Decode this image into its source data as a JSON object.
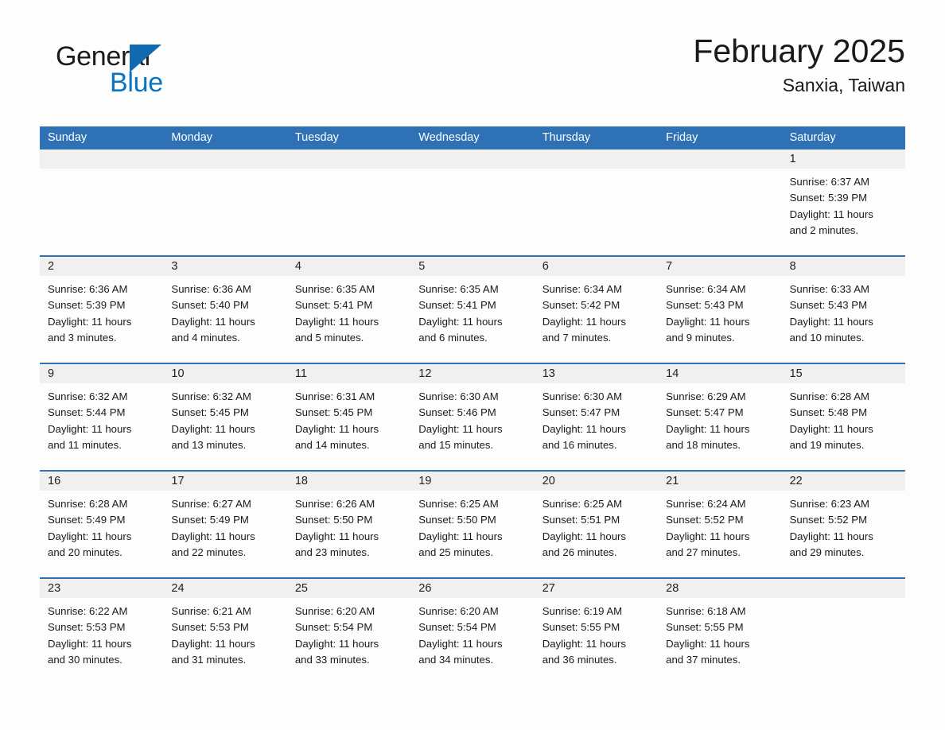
{
  "brand": {
    "name_part1": "General",
    "name_part2": "Blue",
    "accent_color": "#0a73c2",
    "triangle_color": "#1169b0"
  },
  "header": {
    "title": "February 2025",
    "subtitle": "Sanxia, Taiwan"
  },
  "calendar": {
    "header_bg": "#2e71b4",
    "header_text_color": "#ffffff",
    "daynum_band_bg": "#f0f0f0",
    "weekdays": [
      "Sunday",
      "Monday",
      "Tuesday",
      "Wednesday",
      "Thursday",
      "Friday",
      "Saturday"
    ],
    "weeks": [
      [
        {
          "day": "",
          "empty": true
        },
        {
          "day": "",
          "empty": true
        },
        {
          "day": "",
          "empty": true
        },
        {
          "day": "",
          "empty": true
        },
        {
          "day": "",
          "empty": true
        },
        {
          "day": "",
          "empty": true
        },
        {
          "day": "1",
          "sunrise": "Sunrise: 6:37 AM",
          "sunset": "Sunset: 5:39 PM",
          "daylight_line1": "Daylight: 11 hours",
          "daylight_line2": "and 2 minutes."
        }
      ],
      [
        {
          "day": "2",
          "sunrise": "Sunrise: 6:36 AM",
          "sunset": "Sunset: 5:39 PM",
          "daylight_line1": "Daylight: 11 hours",
          "daylight_line2": "and 3 minutes."
        },
        {
          "day": "3",
          "sunrise": "Sunrise: 6:36 AM",
          "sunset": "Sunset: 5:40 PM",
          "daylight_line1": "Daylight: 11 hours",
          "daylight_line2": "and 4 minutes."
        },
        {
          "day": "4",
          "sunrise": "Sunrise: 6:35 AM",
          "sunset": "Sunset: 5:41 PM",
          "daylight_line1": "Daylight: 11 hours",
          "daylight_line2": "and 5 minutes."
        },
        {
          "day": "5",
          "sunrise": "Sunrise: 6:35 AM",
          "sunset": "Sunset: 5:41 PM",
          "daylight_line1": "Daylight: 11 hours",
          "daylight_line2": "and 6 minutes."
        },
        {
          "day": "6",
          "sunrise": "Sunrise: 6:34 AM",
          "sunset": "Sunset: 5:42 PM",
          "daylight_line1": "Daylight: 11 hours",
          "daylight_line2": "and 7 minutes."
        },
        {
          "day": "7",
          "sunrise": "Sunrise: 6:34 AM",
          "sunset": "Sunset: 5:43 PM",
          "daylight_line1": "Daylight: 11 hours",
          "daylight_line2": "and 9 minutes."
        },
        {
          "day": "8",
          "sunrise": "Sunrise: 6:33 AM",
          "sunset": "Sunset: 5:43 PM",
          "daylight_line1": "Daylight: 11 hours",
          "daylight_line2": "and 10 minutes."
        }
      ],
      [
        {
          "day": "9",
          "sunrise": "Sunrise: 6:32 AM",
          "sunset": "Sunset: 5:44 PM",
          "daylight_line1": "Daylight: 11 hours",
          "daylight_line2": "and 11 minutes."
        },
        {
          "day": "10",
          "sunrise": "Sunrise: 6:32 AM",
          "sunset": "Sunset: 5:45 PM",
          "daylight_line1": "Daylight: 11 hours",
          "daylight_line2": "and 13 minutes."
        },
        {
          "day": "11",
          "sunrise": "Sunrise: 6:31 AM",
          "sunset": "Sunset: 5:45 PM",
          "daylight_line1": "Daylight: 11 hours",
          "daylight_line2": "and 14 minutes."
        },
        {
          "day": "12",
          "sunrise": "Sunrise: 6:30 AM",
          "sunset": "Sunset: 5:46 PM",
          "daylight_line1": "Daylight: 11 hours",
          "daylight_line2": "and 15 minutes."
        },
        {
          "day": "13",
          "sunrise": "Sunrise: 6:30 AM",
          "sunset": "Sunset: 5:47 PM",
          "daylight_line1": "Daylight: 11 hours",
          "daylight_line2": "and 16 minutes."
        },
        {
          "day": "14",
          "sunrise": "Sunrise: 6:29 AM",
          "sunset": "Sunset: 5:47 PM",
          "daylight_line1": "Daylight: 11 hours",
          "daylight_line2": "and 18 minutes."
        },
        {
          "day": "15",
          "sunrise": "Sunrise: 6:28 AM",
          "sunset": "Sunset: 5:48 PM",
          "daylight_line1": "Daylight: 11 hours",
          "daylight_line2": "and 19 minutes."
        }
      ],
      [
        {
          "day": "16",
          "sunrise": "Sunrise: 6:28 AM",
          "sunset": "Sunset: 5:49 PM",
          "daylight_line1": "Daylight: 11 hours",
          "daylight_line2": "and 20 minutes."
        },
        {
          "day": "17",
          "sunrise": "Sunrise: 6:27 AM",
          "sunset": "Sunset: 5:49 PM",
          "daylight_line1": "Daylight: 11 hours",
          "daylight_line2": "and 22 minutes."
        },
        {
          "day": "18",
          "sunrise": "Sunrise: 6:26 AM",
          "sunset": "Sunset: 5:50 PM",
          "daylight_line1": "Daylight: 11 hours",
          "daylight_line2": "and 23 minutes."
        },
        {
          "day": "19",
          "sunrise": "Sunrise: 6:25 AM",
          "sunset": "Sunset: 5:50 PM",
          "daylight_line1": "Daylight: 11 hours",
          "daylight_line2": "and 25 minutes."
        },
        {
          "day": "20",
          "sunrise": "Sunrise: 6:25 AM",
          "sunset": "Sunset: 5:51 PM",
          "daylight_line1": "Daylight: 11 hours",
          "daylight_line2": "and 26 minutes."
        },
        {
          "day": "21",
          "sunrise": "Sunrise: 6:24 AM",
          "sunset": "Sunset: 5:52 PM",
          "daylight_line1": "Daylight: 11 hours",
          "daylight_line2": "and 27 minutes."
        },
        {
          "day": "22",
          "sunrise": "Sunrise: 6:23 AM",
          "sunset": "Sunset: 5:52 PM",
          "daylight_line1": "Daylight: 11 hours",
          "daylight_line2": "and 29 minutes."
        }
      ],
      [
        {
          "day": "23",
          "sunrise": "Sunrise: 6:22 AM",
          "sunset": "Sunset: 5:53 PM",
          "daylight_line1": "Daylight: 11 hours",
          "daylight_line2": "and 30 minutes."
        },
        {
          "day": "24",
          "sunrise": "Sunrise: 6:21 AM",
          "sunset": "Sunset: 5:53 PM",
          "daylight_line1": "Daylight: 11 hours",
          "daylight_line2": "and 31 minutes."
        },
        {
          "day": "25",
          "sunrise": "Sunrise: 6:20 AM",
          "sunset": "Sunset: 5:54 PM",
          "daylight_line1": "Daylight: 11 hours",
          "daylight_line2": "and 33 minutes."
        },
        {
          "day": "26",
          "sunrise": "Sunrise: 6:20 AM",
          "sunset": "Sunset: 5:54 PM",
          "daylight_line1": "Daylight: 11 hours",
          "daylight_line2": "and 34 minutes."
        },
        {
          "day": "27",
          "sunrise": "Sunrise: 6:19 AM",
          "sunset": "Sunset: 5:55 PM",
          "daylight_line1": "Daylight: 11 hours",
          "daylight_line2": "and 36 minutes."
        },
        {
          "day": "28",
          "sunrise": "Sunrise: 6:18 AM",
          "sunset": "Sunset: 5:55 PM",
          "daylight_line1": "Daylight: 11 hours",
          "daylight_line2": "and 37 minutes."
        },
        {
          "day": "",
          "empty": true
        }
      ]
    ]
  }
}
